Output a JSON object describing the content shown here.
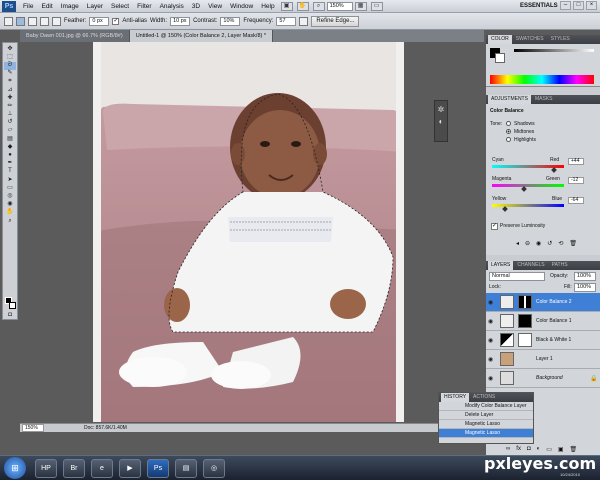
{
  "menubar": {
    "logo": "Ps",
    "items": [
      "File",
      "Edit",
      "Image",
      "Layer",
      "Select",
      "Filter",
      "Analysis",
      "3D",
      "View",
      "Window",
      "Help"
    ],
    "zoom": "150%",
    "workspace": "ESSENTIALS"
  },
  "options": {
    "feather_label": "Feather:",
    "feather_value": "0 px",
    "antialias_label": "Anti-alias",
    "width_label": "Width:",
    "width_value": "10 px",
    "contrast_label": "Contrast:",
    "contrast_value": "10%",
    "frequency_label": "Frequency:",
    "frequency_value": "57",
    "refine_label": "Refine Edge..."
  },
  "tabs": [
    "Baby Dawn 001.jpg @ 66.7% (RGB/8#)",
    "Untitled-1 @ 150% (Color Balance 2, Layer Mask/8) *"
  ],
  "status": {
    "zoom": "150%",
    "doc": "Doc: 857.6K/1.40M"
  },
  "color_panel": {
    "tabs": [
      "COLOR",
      "SWATCHES",
      "STYLES"
    ]
  },
  "adjustments": {
    "tabs": [
      "ADJUSTMENTS",
      "MASKS"
    ],
    "title": "Color Balance",
    "tone_label": "Tone:",
    "tones": [
      "Shadows",
      "Midtones",
      "Highlights"
    ],
    "selected_tone": 1,
    "sliders": [
      {
        "left": "Cyan",
        "right": "Red",
        "value": "+44",
        "pos": 0.86
      },
      {
        "left": "Magenta",
        "right": "Green",
        "value": "-12",
        "pos": 0.44
      },
      {
        "left": "Yellow",
        "right": "Blue",
        "value": "-64",
        "pos": 0.18
      }
    ],
    "preserve_label": "Preserve Luminosity"
  },
  "layers": {
    "tabs": [
      "LAYERS",
      "CHANNELS",
      "PATHS"
    ],
    "blend": "Normal",
    "opacity_label": "Opacity:",
    "opacity": "100%",
    "lock_label": "Lock:",
    "fill_label": "Fill:",
    "fill": "100%",
    "items": [
      {
        "name": "Color Balance 2",
        "selected": true
      },
      {
        "name": "Color Balance 1",
        "selected": false
      },
      {
        "name": "Black & White 1",
        "selected": false
      },
      {
        "name": "Layer 1",
        "selected": false
      },
      {
        "name": "Background",
        "selected": false
      }
    ]
  },
  "history": {
    "tabs": [
      "HISTORY",
      "ACTIONS"
    ],
    "items": [
      "Modify Color Balance Layer",
      "Delete Layer",
      "Magnetic Lasso",
      "Magnetic Lasso"
    ],
    "selected": 3
  },
  "taskbar": {
    "brand": "pxleyes.com",
    "clock": "10/24/2010",
    "apps": [
      "HP",
      "Br",
      "e",
      "▶",
      "Ps",
      "▤",
      "◎"
    ]
  },
  "colors": {
    "accent": "#3f7fd6",
    "couch": "#b58a8f",
    "chrome": "#5b5b5b"
  }
}
